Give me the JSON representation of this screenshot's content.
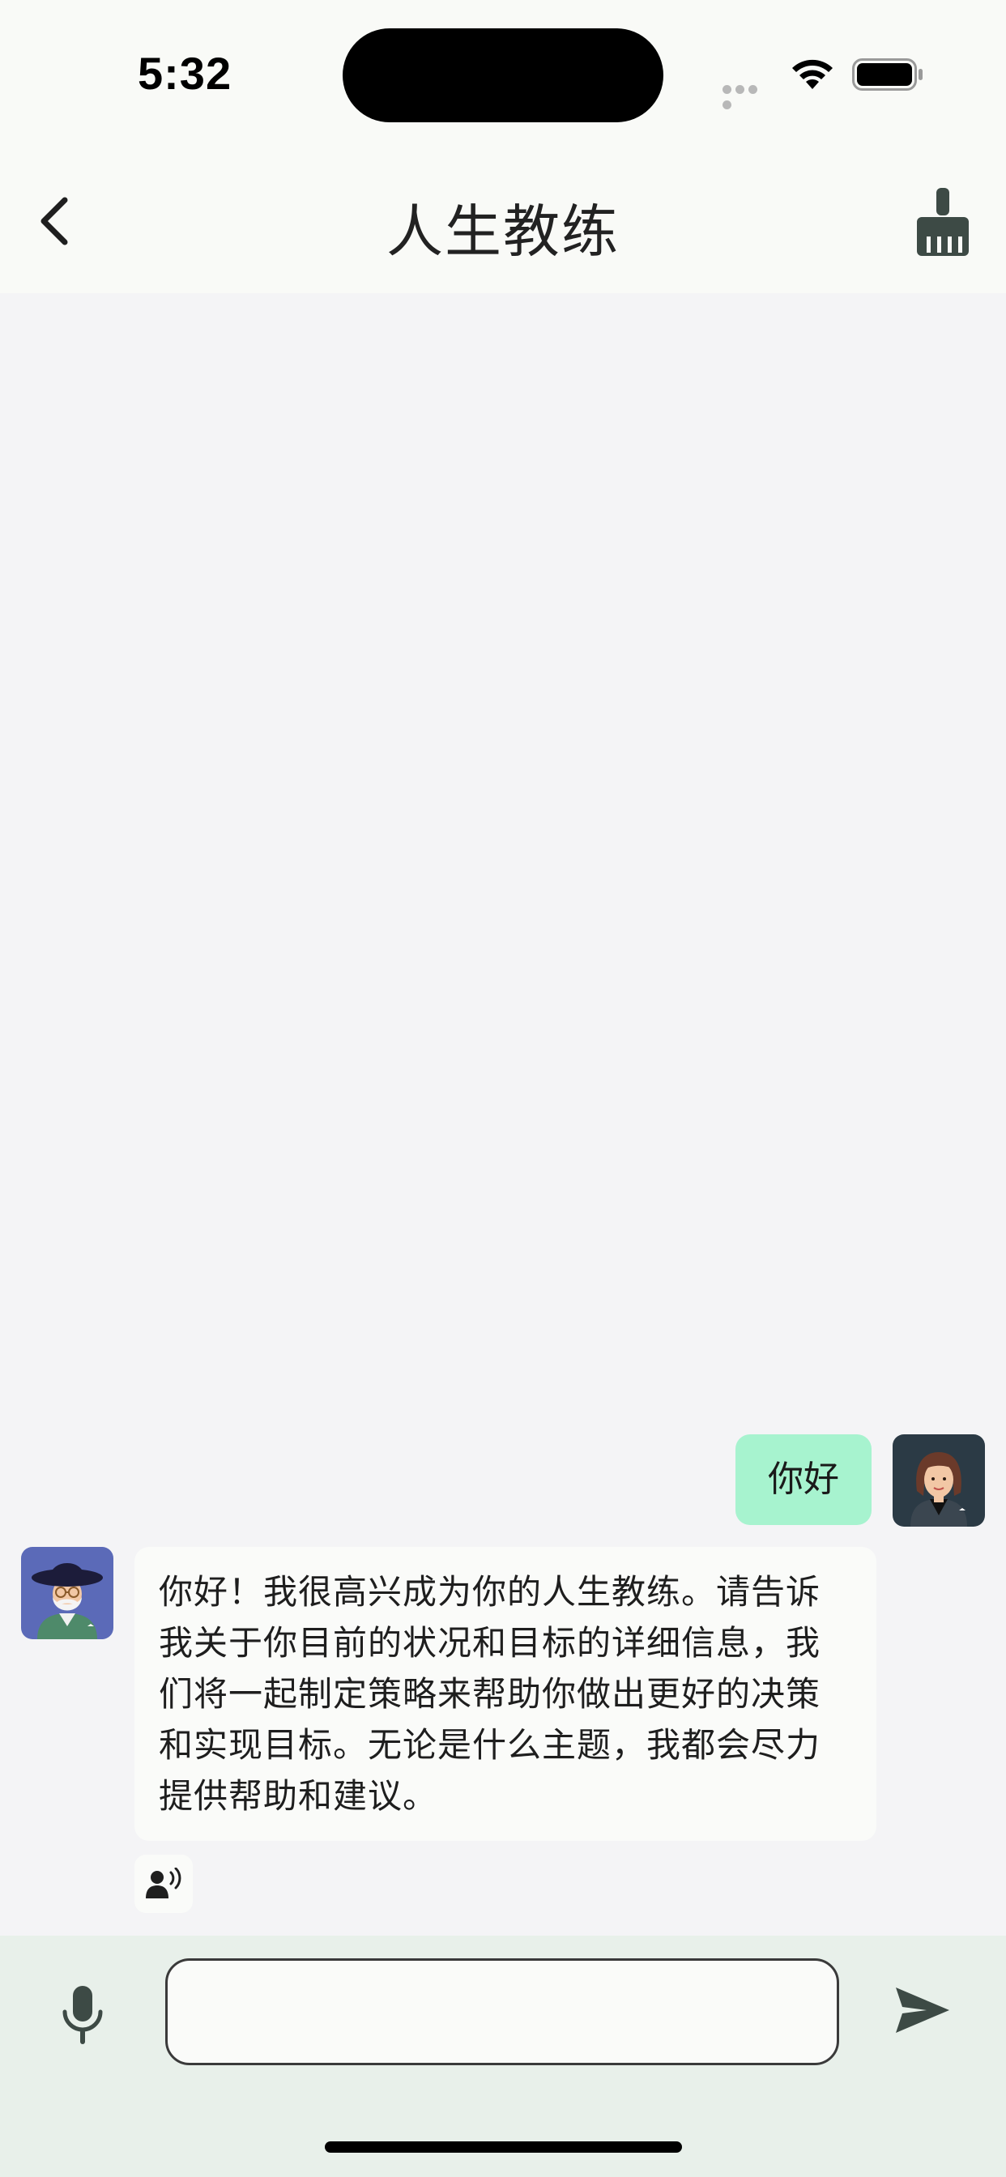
{
  "status_bar": {
    "time": "5:32"
  },
  "nav": {
    "title": "人生教练",
    "back_icon": "chevron-left-icon",
    "clear_icon": "broom-icon"
  },
  "chat": {
    "messages": [
      {
        "role": "user",
        "text": "你好"
      },
      {
        "role": "assistant",
        "text": "你好！我很高兴成为你的人生教练。请告诉我关于你目前的状况和目标的详细信息，我们将一起制定策略来帮助你做出更好的决策和实现目标。无论是什么主题，我都会尽力提供帮助和建议。"
      }
    ]
  },
  "input": {
    "value": "",
    "placeholder": ""
  },
  "colors": {
    "user_bubble": "#a7f3cf",
    "bot_bubble": "#fafbf9",
    "chat_background": "#f4f4f6",
    "input_bar": "#e8f0ea",
    "icon": "#3d4a45"
  }
}
